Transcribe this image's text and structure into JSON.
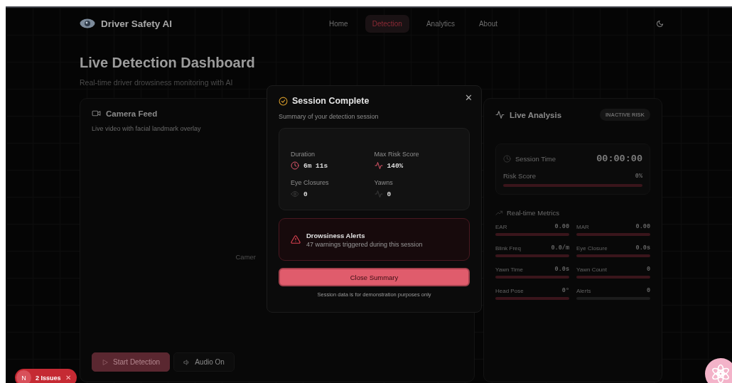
{
  "brand": {
    "name": "Driver Safety AI"
  },
  "nav": [
    {
      "label": "Home",
      "selected": false
    },
    {
      "label": "Detection",
      "selected": true
    },
    {
      "label": "Analytics",
      "selected": false
    },
    {
      "label": "About",
      "selected": false
    }
  ],
  "header": {
    "title": "Live Detection Dashboard",
    "subtitle": "Real-time driver drowsiness monitoring with AI"
  },
  "camera_card": {
    "title": "Camera Feed",
    "subtitle": "Live video with facial landmark overlay",
    "placeholder_text": "Camer",
    "buttons": [
      {
        "label": "Start Detection",
        "kind": "primary"
      },
      {
        "label": "Audio On",
        "kind": "audio"
      }
    ]
  },
  "analysis_card": {
    "title": "Live Analysis",
    "badge": "INACTIVE RISK",
    "session_time_label": "Session Time",
    "session_time": "00:00:00",
    "risk_label": "Risk Score",
    "risk_value": "0%",
    "risk_bar": {
      "level": 0
    },
    "metrics_title": "Real-time Metrics",
    "metrics": [
      {
        "label": "EAR",
        "value": "0.00",
        "active": true
      },
      {
        "label": "MAR",
        "value": "0.00",
        "active": true
      },
      {
        "label": "Blink Freq",
        "value": "0.0/m",
        "active": true
      },
      {
        "label": "Eye Closure",
        "value": "0.0s",
        "active": true
      },
      {
        "label": "Yawn Time",
        "value": "0.0s",
        "active": true
      },
      {
        "label": "Yawn Count",
        "value": "0",
        "active": true
      },
      {
        "label": "Head Pose",
        "value": "0°",
        "active": true
      },
      {
        "label": "Alerts",
        "value": "0",
        "active": false
      }
    ]
  },
  "modal": {
    "title": "Session Complete",
    "close_symbol": "✕",
    "subtitle": "Summary of your detection session",
    "stats": [
      {
        "label": "Duration",
        "value": "6m 11s",
        "kind": "clock",
        "highlight": true
      },
      {
        "label": "Max Risk Score",
        "value": "140%",
        "kind": "pulse",
        "highlight": true
      },
      {
        "label": "Eye Closures",
        "value": "0",
        "kind": "eye",
        "highlight": false
      },
      {
        "label": "Yawns",
        "value": "0",
        "kind": "pulse",
        "highlight": false
      }
    ],
    "alert_title": "Drowsiness Alerts",
    "alert_text": "47 warnings triggered during this session",
    "button": "Close Summary",
    "footnote": "Session data is for demonstration purposes only"
  },
  "issues_badge": {
    "letter": "N",
    "label": "2 Issues",
    "close_symbol": "✕"
  }
}
